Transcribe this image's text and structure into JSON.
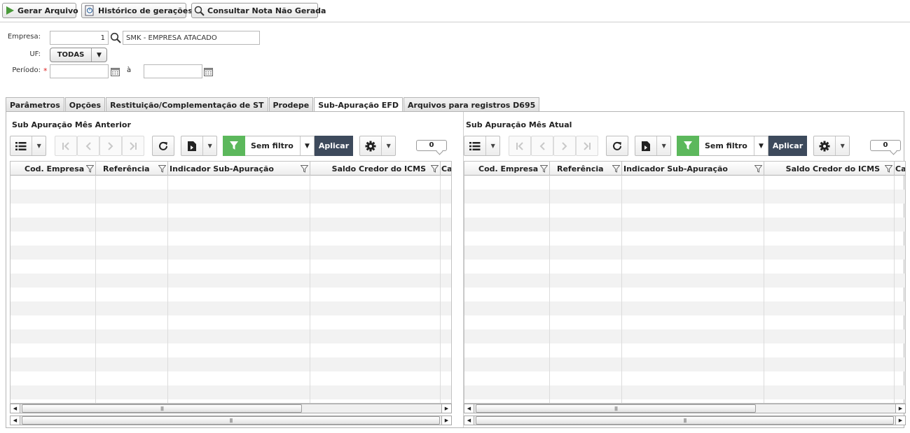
{
  "toolbar": {
    "gerar_label": "Gerar Arquivo",
    "historico_label": "Histórico de gerações",
    "consultar_label": "Consultar Nota Não Gerada"
  },
  "form": {
    "empresa_label": "Empresa:",
    "empresa_code": "1",
    "empresa_name": "SMK - EMPRESA ATACADO",
    "uf_label": "UF:",
    "uf_value": "TODAS",
    "periodo_label": "Período:",
    "periodo_required": "*",
    "periodo_sep": "à",
    "periodo_from": "",
    "periodo_to": ""
  },
  "tabs": [
    {
      "label": "Parâmetros"
    },
    {
      "label": "Opções"
    },
    {
      "label": "Restituição/Complementação de ST"
    },
    {
      "label": "Prodepe"
    },
    {
      "label": "Sub-Apuração EFD",
      "active": true
    },
    {
      "label": "Arquivos para registros D695"
    }
  ],
  "panels": {
    "left": {
      "title": "Sub Apuração Mês Anterior",
      "filter_value": "Sem filtro",
      "apply_label": "Aplicar",
      "count": "0"
    },
    "right": {
      "title": "Sub Apuração Mês Atual",
      "filter_value": "Sem filtro",
      "apply_label": "Aplicar",
      "count": "0"
    }
  },
  "grid": {
    "columns": [
      {
        "label": "Cod. Empresa"
      },
      {
        "label": "Referência"
      },
      {
        "label": "Indicador Sub-Apuração"
      },
      {
        "label": "Saldo Credor do ICMS"
      },
      {
        "label": "Ca"
      }
    ],
    "rows": []
  },
  "icons": {
    "gerar": "play-icon",
    "historico": "history-icon",
    "consultar": "search-icon",
    "lookup": "search-icon",
    "calendar": "calendar-icon",
    "list": "list-icon",
    "refresh": "refresh-icon",
    "export": "export-icon",
    "filter": "filter-icon",
    "settings": "gear-icon"
  },
  "colors": {
    "filter_green": "#5cb85c",
    "apply_dark": "#3d4a5c",
    "required_red": "#dd2222"
  }
}
